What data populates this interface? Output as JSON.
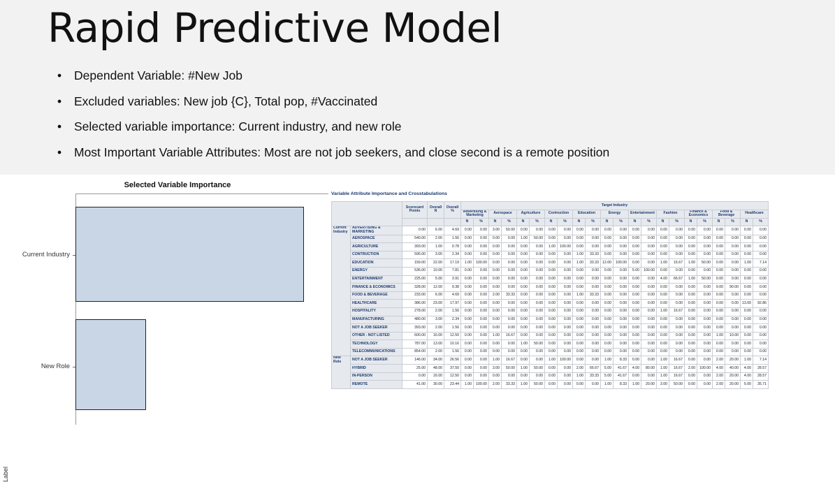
{
  "slide": {
    "title": "Rapid Predictive Model",
    "bullets": [
      "Dependent Variable: #New Job",
      "Excluded variables: New job {C}, Total pop, #Vaccinated",
      "Selected variable importance: Current industry, and new role",
      "Most Important Variable Attributes: Most are not job seekers, and close second is a remote position"
    ]
  },
  "chart_data": {
    "type": "bar",
    "orientation": "horizontal",
    "title": "Selected Variable Importance",
    "xlabel": "",
    "ylabel": "Label",
    "categories": [
      "Current Industry",
      "New Role"
    ],
    "values": [
      1.0,
      0.31
    ],
    "xlim": [
      0,
      1.0
    ],
    "grid": false,
    "legend": "none",
    "bar_color": "#c9d6e6"
  },
  "crosstab": {
    "title": "Variable Attribute Importance and Crosstabulations",
    "header_scorecard": "Scorecard Points",
    "header_overall_n": "Overall N",
    "header_overall_pct": "Overall %",
    "target_header": "Target Industry",
    "n_label": "N",
    "pct_label": "%",
    "targets": [
      "Advertising & Marketing",
      "Aerospace",
      "Agriculture",
      "Contruction",
      "Education",
      "Energy",
      "Entertainment",
      "Fashion",
      "Finance & Economics",
      "Food & Beverage",
      "Healthcare"
    ],
    "groups": [
      {
        "label": "Current Industry",
        "rows": [
          {
            "label": "ADVERTISING & MARKETING",
            "pts": "0.00",
            "n": "6.00",
            "pct": "4.69",
            "cells": [
              "0.00",
              "0.00",
              "3.00",
              "50.00",
              "0.00",
              "0.00",
              "0.00",
              "0.00",
              "0.00",
              "0.00",
              "0.00",
              "0.00",
              "0.00",
              "0.00",
              "0.00",
              "0.00",
              "0.00",
              "0.00",
              "0.00",
              "0.00",
              "0.00",
              "0.00"
            ]
          },
          {
            "label": "AEROSPACE",
            "pts": "540.00",
            "n": "2.00",
            "pct": "1.56",
            "cells": [
              "0.00",
              "0.00",
              "0.00",
              "0.00",
              "1.00",
              "50.00",
              "0.00",
              "0.00",
              "0.00",
              "0.00",
              "0.00",
              "0.00",
              "0.00",
              "0.00",
              "0.00",
              "0.00",
              "0.00",
              "0.00",
              "0.00",
              "0.00",
              "0.00",
              "0.00"
            ]
          },
          {
            "label": "AGRICULTURE",
            "pts": "393.00",
            "n": "1.00",
            "pct": "0.78",
            "cells": [
              "0.00",
              "0.00",
              "0.00",
              "0.00",
              "0.00",
              "0.00",
              "1.00",
              "100.00",
              "0.00",
              "0.00",
              "0.00",
              "0.00",
              "0.00",
              "0.00",
              "0.00",
              "0.00",
              "0.00",
              "0.00",
              "0.00",
              "0.00",
              "0.00",
              "0.00"
            ]
          },
          {
            "label": "CONTRUCTION",
            "pts": "595.00",
            "n": "3.00",
            "pct": "2.34",
            "cells": [
              "0.00",
              "0.00",
              "0.00",
              "0.00",
              "0.00",
              "0.00",
              "0.00",
              "0.00",
              "1.00",
              "33.33",
              "0.00",
              "0.00",
              "0.00",
              "0.00",
              "0.00",
              "0.00",
              "0.00",
              "0.00",
              "0.00",
              "0.00",
              "0.00",
              "0.00"
            ]
          },
          {
            "label": "EDUCATION",
            "pts": "159.00",
            "n": "22.00",
            "pct": "17.19",
            "cells": [
              "1.00",
              "100.00",
              "0.00",
              "0.00",
              "0.00",
              "0.00",
              "0.00",
              "0.00",
              "1.00",
              "33.33",
              "12.00",
              "100.00",
              "0.00",
              "0.00",
              "1.00",
              "16.67",
              "1.00",
              "50.00",
              "0.00",
              "0.00",
              "0.00",
              "0.00"
            ]
          },
          {
            "label": "ENERGY",
            "pts": "536.00",
            "n": "10.00",
            "pct": "7.81",
            "cells": [
              "0.00",
              "0.00",
              "0.00",
              "0.00",
              "0.00",
              "0.00",
              "0.00",
              "0.00",
              "0.00",
              "0.00",
              "0.00",
              "0.00",
              "5.00",
              "100.00",
              "0.00",
              "0.00",
              "0.00",
              "0.00",
              "0.00",
              "0.00",
              "0.00",
              "0.00"
            ]
          },
          {
            "label": "ENTERTAINMENT",
            "pts": "225.00",
            "n": "5.00",
            "pct": "3.91",
            "cells": [
              "0.00",
              "0.00",
              "0.00",
              "0.00",
              "0.00",
              "0.00",
              "0.00",
              "0.00",
              "0.00",
              "0.00",
              "0.00",
              "0.00",
              "0.00",
              "0.00",
              "4.00",
              "66.67",
              "1.00",
              "50.00",
              "0.00",
              "0.00",
              "0.00",
              "0.00"
            ]
          },
          {
            "label": "FINANCE & ECONOMICS",
            "pts": "328.00",
            "n": "12.00",
            "pct": "9.38",
            "cells": [
              "0.00",
              "0.00",
              "0.00",
              "0.00",
              "0.00",
              "0.00",
              "0.00",
              "0.00",
              "0.00",
              "0.00",
              "0.00",
              "0.00",
              "0.00",
              "0.00",
              "0.00",
              "0.00",
              "0.00",
              "0.00",
              "9.00",
              "90.00",
              "0.00",
              "0.00"
            ]
          },
          {
            "label": "FOOD & BEVERAGE",
            "pts": "233.00",
            "n": "6.00",
            "pct": "4.69",
            "cells": [
              "0.00",
              "0.00",
              "2.00",
              "33.33",
              "0.00",
              "0.00",
              "0.00",
              "0.00",
              "1.00",
              "33.33",
              "0.00",
              "0.00",
              "0.00",
              "0.00",
              "0.00",
              "0.00",
              "0.00",
              "0.00",
              "0.00",
              "0.00",
              "3.00",
              "75.00"
            ]
          },
          {
            "label": "HEALTHCARE",
            "pts": "386.00",
            "n": "23.00",
            "pct": "17.97",
            "cells": [
              "0.00",
              "0.00",
              "0.00",
              "0.00",
              "0.00",
              "0.00",
              "0.00",
              "0.00",
              "0.00",
              "0.00",
              "0.00",
              "0.00",
              "0.00",
              "0.00",
              "0.00",
              "0.00",
              "0.00",
              "0.00",
              "0.00",
              "0.00",
              "1.00",
              "25.00"
            ]
          },
          {
            "label": "HOSPITALITY",
            "pts": "278.00",
            "n": "2.00",
            "pct": "1.56",
            "cells": [
              "0.00",
              "0.00",
              "0.00",
              "0.00",
              "0.00",
              "0.00",
              "0.00",
              "0.00",
              "0.00",
              "0.00",
              "0.00",
              "0.00",
              "0.00",
              "0.00",
              "1.00",
              "16.67",
              "0.00",
              "0.00",
              "0.00",
              "0.00",
              "0.00",
              "0.00"
            ]
          },
          {
            "label": "MANUFACTURING",
            "pts": "480.00",
            "n": "3.00",
            "pct": "2.34",
            "cells": [
              "0.00",
              "0.00",
              "0.00",
              "0.00",
              "0.00",
              "0.00",
              "0.00",
              "0.00",
              "0.00",
              "0.00",
              "0.00",
              "0.00",
              "0.00",
              "0.00",
              "0.00",
              "0.00",
              "0.00",
              "0.00",
              "0.00",
              "0.00",
              "0.00",
              "0.00"
            ]
          },
          {
            "label": "NOT A JOB SEEKER",
            "pts": "393.00",
            "n": "2.00",
            "pct": "1.56",
            "cells": [
              "0.00",
              "0.00",
              "0.00",
              "0.00",
              "0.00",
              "0.00",
              "0.00",
              "0.00",
              "0.00",
              "0.00",
              "0.00",
              "0.00",
              "0.00",
              "0.00",
              "0.00",
              "0.00",
              "0.00",
              "0.00",
              "0.00",
              "0.00",
              "0.00",
              "0.00"
            ]
          },
          {
            "label": "OTHER - NOT LISTED",
            "pts": "600.00",
            "n": "16.00",
            "pct": "12.50",
            "cells": [
              "0.00",
              "0.00",
              "1.00",
              "16.67",
              "0.00",
              "0.00",
              "0.00",
              "0.00",
              "0.00",
              "0.00",
              "0.00",
              "0.00",
              "0.00",
              "0.00",
              "0.00",
              "0.00",
              "0.00",
              "0.00",
              "1.00",
              "10.00",
              "0.00",
              "0.00"
            ]
          },
          {
            "label": "TECHNOLOGY",
            "pts": "787.00",
            "n": "13.00",
            "pct": "10.16",
            "cells": [
              "0.00",
              "0.00",
              "0.00",
              "0.00",
              "1.00",
              "50.00",
              "0.00",
              "0.00",
              "0.00",
              "0.00",
              "0.00",
              "0.00",
              "0.00",
              "0.00",
              "0.00",
              "0.00",
              "0.00",
              "0.00",
              "0.00",
              "0.00",
              "0.00",
              "0.00"
            ]
          },
          {
            "label": "TELECOMMUNICATIONS",
            "pts": "854.00",
            "n": "2.00",
            "pct": "1.56",
            "cells": [
              "0.00",
              "0.00",
              "0.00",
              "0.00",
              "0.00",
              "0.00",
              "0.00",
              "0.00",
              "0.00",
              "0.00",
              "0.00",
              "0.00",
              "0.00",
              "0.00",
              "0.00",
              "0.00",
              "0.00",
              "0.00",
              "0.00",
              "0.00",
              "0.00",
              "0.00"
            ]
          }
        ]
      },
      {
        "label": "New Role",
        "rows": [
          {
            "label": "NOT A JOB SEEKER",
            "pts": "146.00",
            "n": "34.00",
            "pct": "26.56",
            "cells": [
              "0.00",
              "0.00",
              "1.00",
              "16.67",
              "0.00",
              "0.00",
              "1.00",
              "100.00",
              "0.00",
              "0.00",
              "1.00",
              "8.33",
              "0.00",
              "0.00",
              "1.00",
              "16.67",
              "0.00",
              "0.00",
              "2.00",
              "20.00",
              "1.00",
              "25.00"
            ]
          },
          {
            "label": "HYBRID",
            "pts": "25.00",
            "n": "48.00",
            "pct": "37.50",
            "cells": [
              "0.00",
              "0.00",
              "3.00",
              "50.00",
              "1.00",
              "50.00",
              "0.00",
              "0.00",
              "2.00",
              "66.67",
              "5.00",
              "41.67",
              "4.00",
              "80.00",
              "1.00",
              "16.67",
              "2.00",
              "100.00",
              "4.00",
              "40.00",
              "3.00",
              "75.00"
            ]
          },
          {
            "label": "IN-PERSON",
            "pts": "0.00",
            "n": "16.00",
            "pct": "12.50",
            "cells": [
              "0.00",
              "0.00",
              "0.00",
              "0.00",
              "0.00",
              "0.00",
              "0.00",
              "0.00",
              "1.00",
              "33.33",
              "5.00",
              "41.67",
              "0.00",
              "0.00",
              "1.00",
              "16.67",
              "0.00",
              "0.00",
              "2.00",
              "20.00",
              "0.00",
              "0.00"
            ]
          },
          {
            "label": "REMOTE",
            "pts": "41.00",
            "n": "30.00",
            "pct": "23.44",
            "cells": [
              "1.00",
              "100.00",
              "2.00",
              "33.33",
              "1.00",
              "50.00",
              "0.00",
              "0.00",
              "0.00",
              "0.00",
              "1.00",
              "8.33",
              "1.00",
              "20.00",
              "3.00",
              "50.00",
              "0.00",
              "0.00",
              "2.00",
              "20.00",
              "0.00",
              "0.00"
            ]
          }
        ]
      }
    ],
    "healthcare_cells": {
      "ADVERTISING & MARKETING": [
        "0.00",
        "0.00"
      ],
      "AEROSPACE": [
        "0.00",
        "0.00"
      ],
      "AGRICULTURE": [
        "0.00",
        "0.00"
      ],
      "CONTRUCTION": [
        "0.00",
        "0.00"
      ],
      "EDUCATION": [
        "1.00",
        "7.14"
      ],
      "ENERGY": [
        "0.00",
        "0.00"
      ],
      "ENTERTAINMENT": [
        "0.00",
        "0.00"
      ],
      "FINANCE & ECONOMICS": [
        "0.00",
        "0.00"
      ],
      "FOOD & BEVERAGE": [
        "0.00",
        "0.00"
      ],
      "HEALTHCARE": [
        "13.00",
        "92.86"
      ],
      "HOSPITALITY": [
        "0.00",
        "0.00"
      ],
      "MANUFACTURING": [
        "0.00",
        "0.00"
      ],
      "NOT A JOB SEEKER": [
        "0.00",
        "0.00"
      ],
      "OTHER - NOT LISTED": [
        "0.00",
        "0.00"
      ],
      "TECHNOLOGY": [
        "0.00",
        "0.00"
      ],
      "TELECOMMUNICATIONS": [
        "0.00",
        "0.00"
      ],
      "NR:NOT A JOB SEEKER": [
        "1.00",
        "7.14"
      ],
      "NR:HYBRID": [
        "4.00",
        "28.57"
      ],
      "NR:IN-PERSON": [
        "4.00",
        "28.57"
      ],
      "NR:REMOTE": [
        "5.00",
        "35.71"
      ]
    }
  }
}
